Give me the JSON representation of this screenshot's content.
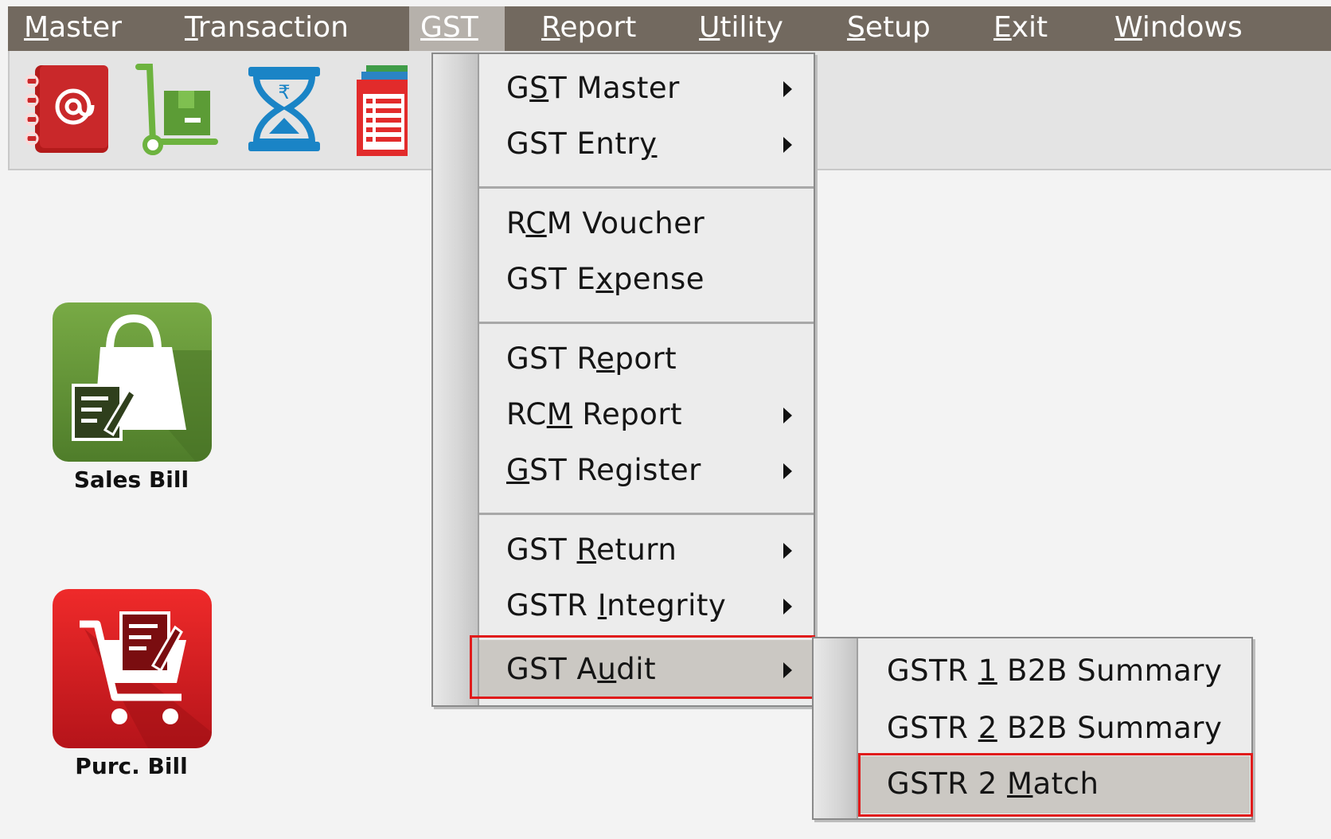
{
  "menubar": {
    "items": [
      {
        "pre": "",
        "u": "M",
        "post": "aster"
      },
      {
        "pre": "",
        "u": "T",
        "post": "ransaction"
      },
      {
        "pre": "",
        "u": "G",
        "post": "ST"
      },
      {
        "pre": "",
        "u": "R",
        "post": "eport"
      },
      {
        "pre": "",
        "u": "U",
        "post": "tility"
      },
      {
        "pre": "",
        "u": "S",
        "post": "etup"
      },
      {
        "pre": "",
        "u": "E",
        "post": "xit"
      },
      {
        "pre": "",
        "u": "W",
        "post": "indows"
      }
    ]
  },
  "toolbar": {
    "icons": [
      "address-book-icon",
      "trolley-icon",
      "hourglass-rupee-icon",
      "report-list-icon"
    ]
  },
  "desktop": {
    "sales_bill_label": "Sales Bill",
    "purc_bill_label": "Purc. Bill"
  },
  "gst_menu": {
    "items": [
      {
        "pre": "G",
        "u": "S",
        "post": "T Master"
      },
      {
        "pre": "GST Entr",
        "u": "y",
        "post": ""
      },
      {
        "pre": "R",
        "u": "C",
        "post": "M Voucher"
      },
      {
        "pre": "GST E",
        "u": "x",
        "post": "pense"
      },
      {
        "pre": "GST R",
        "u": "e",
        "post": "port"
      },
      {
        "pre": "RC",
        "u": "M",
        "post": " Report"
      },
      {
        "pre": "",
        "u": "G",
        "post": "ST Register"
      },
      {
        "pre": "GST ",
        "u": "R",
        "post": "eturn"
      },
      {
        "pre": "GSTR ",
        "u": "I",
        "post": "ntegrity"
      },
      {
        "pre": "GST A",
        "u": "u",
        "post": "dit"
      }
    ]
  },
  "audit_submenu": {
    "items": [
      {
        "pre": "GSTR ",
        "u": "1",
        "post": " B2B Summary"
      },
      {
        "pre": "GSTR ",
        "u": "2",
        "post": " B2B Summary"
      },
      {
        "pre": "GSTR 2 ",
        "u": "M",
        "post": "atch"
      }
    ]
  },
  "colors": {
    "menubar_bg": "#72695f",
    "highlight_box": "#e01b1b",
    "sales_green": "#5f8f35",
    "purc_red": "#d7191c"
  }
}
